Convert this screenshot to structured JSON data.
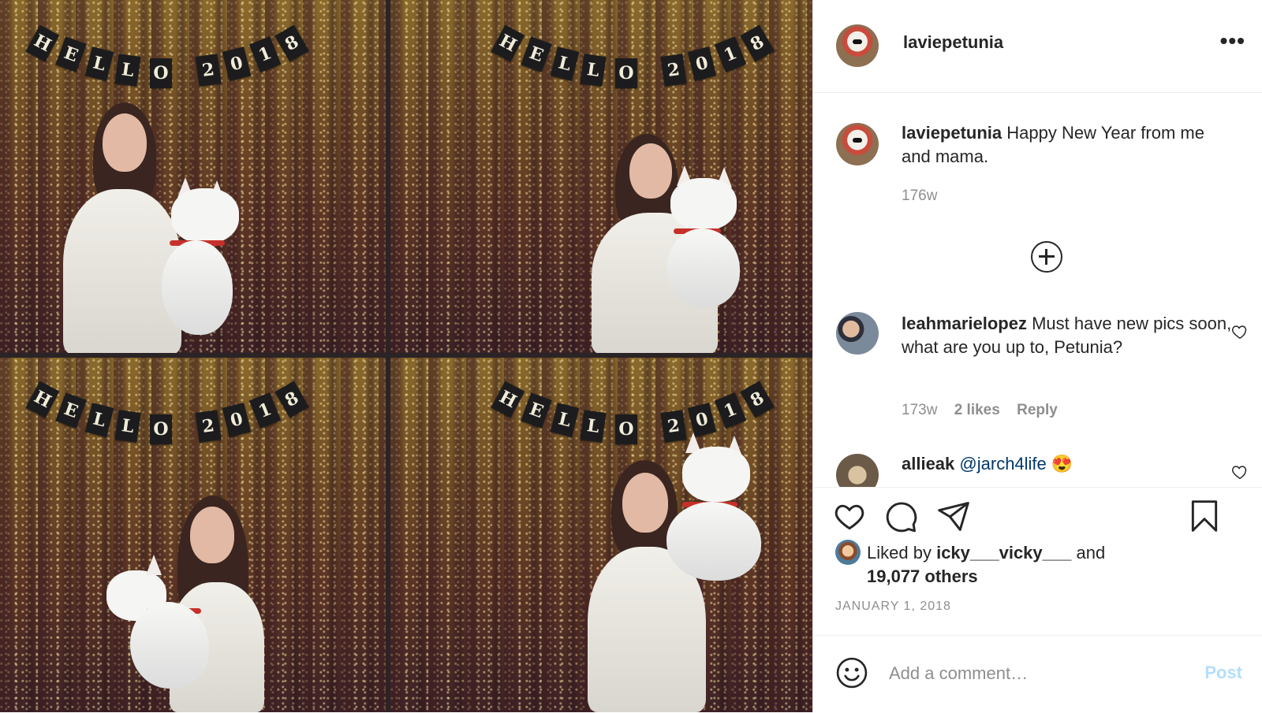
{
  "photo": {
    "banner_letters": [
      "H",
      "E",
      "L",
      "L",
      "O",
      "2",
      "0",
      "1",
      "8"
    ]
  },
  "post_header": {
    "username": "laviepetunia",
    "more_icon": "more-horizontal-icon"
  },
  "caption": {
    "username": "laviepetunia",
    "text": "Happy New Year from me and mama.",
    "age": "176w"
  },
  "comments": [
    {
      "username": "leahmarielopez",
      "text": "Must have new pics soon, what are you up to, Petunia?",
      "age": "173w",
      "likes": "2 likes",
      "reply": "Reply"
    },
    {
      "username": "allieak",
      "mention": "@jarch4life",
      "emoji": "😍"
    }
  ],
  "likes": {
    "prefix": "Liked by",
    "user": "icky___vicky___",
    "and": "and",
    "others": "19,077 others"
  },
  "date": "JANUARY 1, 2018",
  "composer": {
    "placeholder": "Add a comment…",
    "post_label": "Post"
  },
  "colors": {
    "link": "#00376b",
    "post_disabled": "#b2dffc",
    "muted": "#8e8e8e",
    "text": "#262626"
  }
}
